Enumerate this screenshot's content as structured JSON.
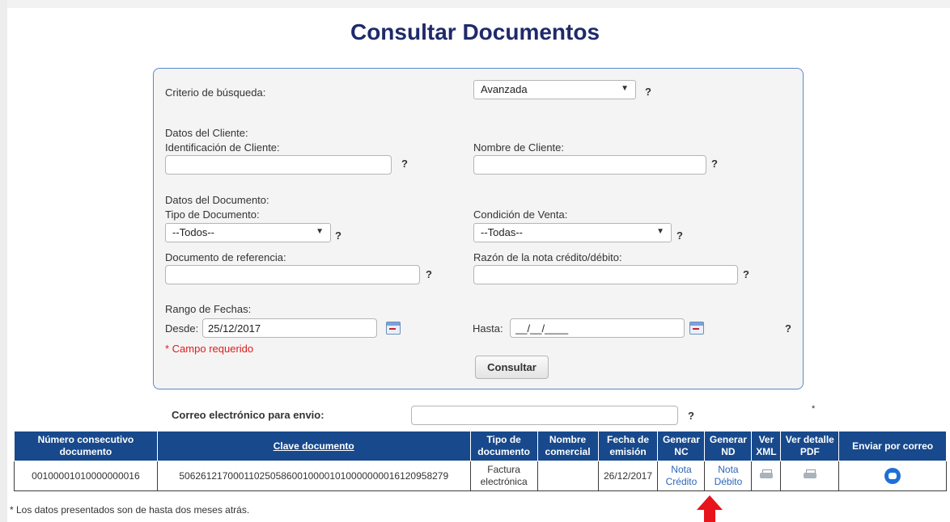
{
  "page": {
    "title": "Consultar Documentos"
  },
  "form": {
    "criterio_label": "Criterio de búsqueda:",
    "criterio_value": "Avanzada",
    "help": "?",
    "datos_cliente": "Datos del Cliente:",
    "id_cliente_label": "Identificación de Cliente:",
    "id_cliente_value": "",
    "nombre_cliente_label": "Nombre de Cliente:",
    "nombre_cliente_value": "",
    "datos_documento": "Datos del Documento:",
    "tipo_doc_label": "Tipo de Documento:",
    "tipo_doc_value": "--Todos--",
    "condicion_label": "Condición de Venta:",
    "condicion_value": "--Todas--",
    "doc_ref_label": "Documento de referencia:",
    "doc_ref_value": "",
    "razon_label": "Razón de la nota crédito/débito:",
    "razon_value": "",
    "rango_label": "Rango de Fechas:",
    "desde_label": "Desde:",
    "desde_value": "25/12/2017",
    "hasta_label": "Hasta:",
    "hasta_value": "__/__/____",
    "requerido": "* Campo requerido",
    "consultar_button": "Consultar",
    "correo_label": "Correo electrónico para envio:",
    "correo_value": "",
    "asterisk": "*"
  },
  "table": {
    "headers": [
      "Número consecutivo documento",
      "Clave documento",
      "Tipo de documento",
      "Nombre comercial",
      "Fecha de emisión",
      "Generar NC",
      "Generar ND",
      "Ver XML",
      "Ver detalle PDF",
      "Enviar por correo"
    ],
    "rows": [
      {
        "consecutivo": "00100001010000000016",
        "clave": "50626121700011025058600100001010000000016120958279",
        "tipo": "Factura electrónica",
        "nombre_comercial": "",
        "fecha": "26/12/2017",
        "nc": "Nota Crédito",
        "nd": "Nota Débito"
      }
    ]
  },
  "footnote": "* Los datos presentados son de hasta dos meses atrás.",
  "icons": {
    "calendar": "calendar-icon",
    "printer": "printer-icon",
    "mail": "mail-icon"
  },
  "colors": {
    "title": "#1f2a6b",
    "header_bg": "#17498c",
    "required": "#e01b1b",
    "arrow": "#e8141b"
  }
}
